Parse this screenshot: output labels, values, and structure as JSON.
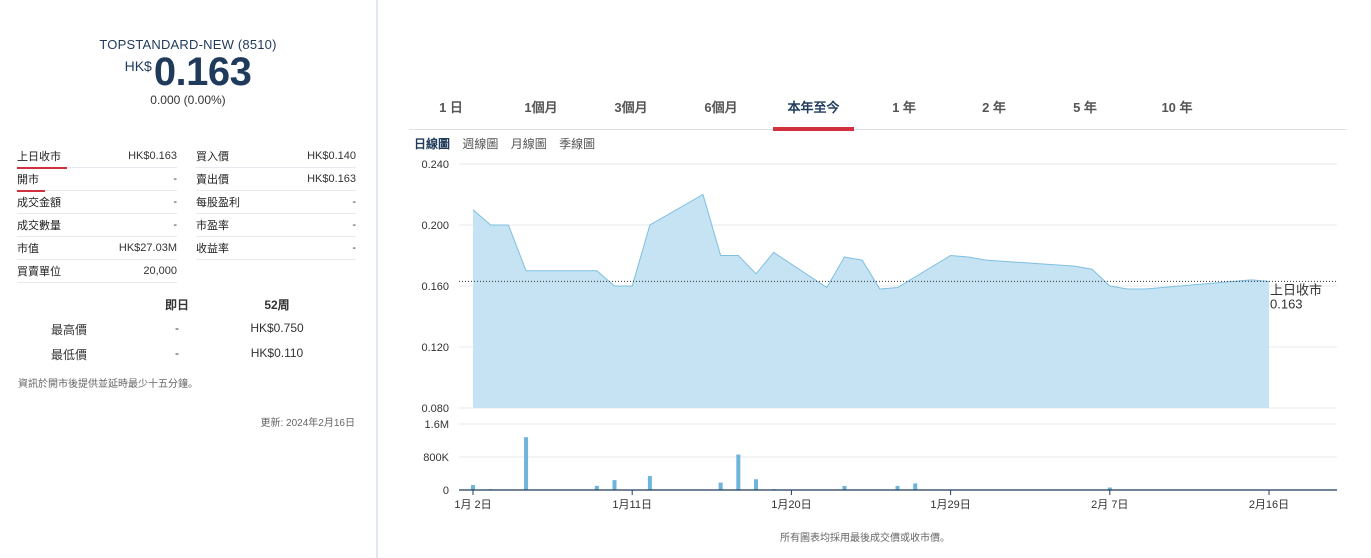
{
  "quote": {
    "name": "TOPSTANDARD-NEW (8510)",
    "currency": "HK$",
    "price": "0.163",
    "change": "0.000 (0.00%)"
  },
  "stats_left": [
    {
      "label": "上日收市",
      "value": "HK$0.163"
    },
    {
      "label": "開市",
      "value": "-"
    },
    {
      "label": "成交金額",
      "value": "-"
    },
    {
      "label": "成交數量",
      "value": "-"
    },
    {
      "label": "市值",
      "value": "HK$27.03M"
    },
    {
      "label": "買賣單位",
      "value": "20,000"
    }
  ],
  "stats_right": [
    {
      "label": "買入價",
      "value": "HK$0.140"
    },
    {
      "label": "賣出價",
      "value": "HK$0.163"
    },
    {
      "label": "每股盈利",
      "value": "-"
    },
    {
      "label": "市盈率",
      "value": "-"
    },
    {
      "label": "收益率",
      "value": "-"
    }
  ],
  "highlow": {
    "col1": "即日",
    "col2": "52周",
    "rows": [
      {
        "label": "最高價",
        "today": "-",
        "week52": "HK$0.750"
      },
      {
        "label": "最低價",
        "today": "-",
        "week52": "HK$0.110"
      }
    ]
  },
  "note": "資訊於開市後提供並延時最少十五分鐘。",
  "updated": "更新: 2024年2月16日",
  "tabs": [
    "1 日",
    "1個月",
    "3個月",
    "6個月",
    "本年至今",
    "1 年",
    "2 年",
    "5 年",
    "10 年"
  ],
  "active_tab": 4,
  "subtabs": [
    "日線圖",
    "週線圖",
    "月線圖",
    "季線圖"
  ],
  "active_subtab": 0,
  "footer_note": "所有圖表均採用最後成交價或收市價。",
  "colors": {
    "accent": "#d0313d",
    "area_fill": "#c5e3f3",
    "area_line": "#7fbfe0",
    "volume_bar": "#6fb4dc",
    "navy": "#1f3a5a"
  },
  "chart_data": {
    "type": "area",
    "x_ticks": [
      "1月 2日",
      "1月11日",
      "1月20日",
      "1月29日",
      "2月 7日",
      "2月16日"
    ],
    "y_ticks": [
      "0.240",
      "0.200",
      "0.160",
      "0.120",
      "0.080"
    ],
    "ylim": [
      0.08,
      0.24
    ],
    "reference_label": "上日收市",
    "reference_value": 0.163,
    "reference_value_text": "0.163",
    "price_series": [
      {
        "x": "2024-01-02",
        "y": 0.21
      },
      {
        "x": "2024-01-03",
        "y": 0.2
      },
      {
        "x": "2024-01-04",
        "y": 0.2
      },
      {
        "x": "2024-01-05",
        "y": 0.17
      },
      {
        "x": "2024-01-08",
        "y": 0.17
      },
      {
        "x": "2024-01-09",
        "y": 0.17
      },
      {
        "x": "2024-01-10",
        "y": 0.16
      },
      {
        "x": "2024-01-11",
        "y": 0.16
      },
      {
        "x": "2024-01-12",
        "y": 0.2
      },
      {
        "x": "2024-01-15",
        "y": 0.22
      },
      {
        "x": "2024-01-16",
        "y": 0.18
      },
      {
        "x": "2024-01-17",
        "y": 0.18
      },
      {
        "x": "2024-01-18",
        "y": 0.168
      },
      {
        "x": "2024-01-19",
        "y": 0.182
      },
      {
        "x": "2024-01-22",
        "y": 0.159
      },
      {
        "x": "2024-01-23",
        "y": 0.179
      },
      {
        "x": "2024-01-24",
        "y": 0.177
      },
      {
        "x": "2024-01-25",
        "y": 0.158
      },
      {
        "x": "2024-01-26",
        "y": 0.159
      },
      {
        "x": "2024-01-29",
        "y": 0.18
      },
      {
        "x": "2024-01-30",
        "y": 0.179
      },
      {
        "x": "2024-01-31",
        "y": 0.177
      },
      {
        "x": "2024-02-05",
        "y": 0.173
      },
      {
        "x": "2024-02-06",
        "y": 0.171
      },
      {
        "x": "2024-02-07",
        "y": 0.16
      },
      {
        "x": "2024-02-08",
        "y": 0.158
      },
      {
        "x": "2024-02-09",
        "y": 0.158
      },
      {
        "x": "2024-02-14",
        "y": 0.163
      },
      {
        "x": "2024-02-15",
        "y": 0.164
      },
      {
        "x": "2024-02-16",
        "y": 0.163
      }
    ],
    "volume_ticks": [
      "1.6M",
      "800K",
      "0"
    ],
    "volume_ylim": [
      0,
      1600000
    ],
    "volume_series": [
      {
        "x": "2024-01-02",
        "v": 120000
      },
      {
        "x": "2024-01-03",
        "v": 20000
      },
      {
        "x": "2024-01-05",
        "v": 1280000
      },
      {
        "x": "2024-01-09",
        "v": 100000
      },
      {
        "x": "2024-01-10",
        "v": 240000
      },
      {
        "x": "2024-01-12",
        "v": 340000
      },
      {
        "x": "2024-01-16",
        "v": 180000
      },
      {
        "x": "2024-01-17",
        "v": 860000
      },
      {
        "x": "2024-01-18",
        "v": 260000
      },
      {
        "x": "2024-01-19",
        "v": 20000
      },
      {
        "x": "2024-01-23",
        "v": 100000
      },
      {
        "x": "2024-01-26",
        "v": 100000
      },
      {
        "x": "2024-01-27",
        "v": 160000
      },
      {
        "x": "2024-02-07",
        "v": 60000
      }
    ]
  }
}
